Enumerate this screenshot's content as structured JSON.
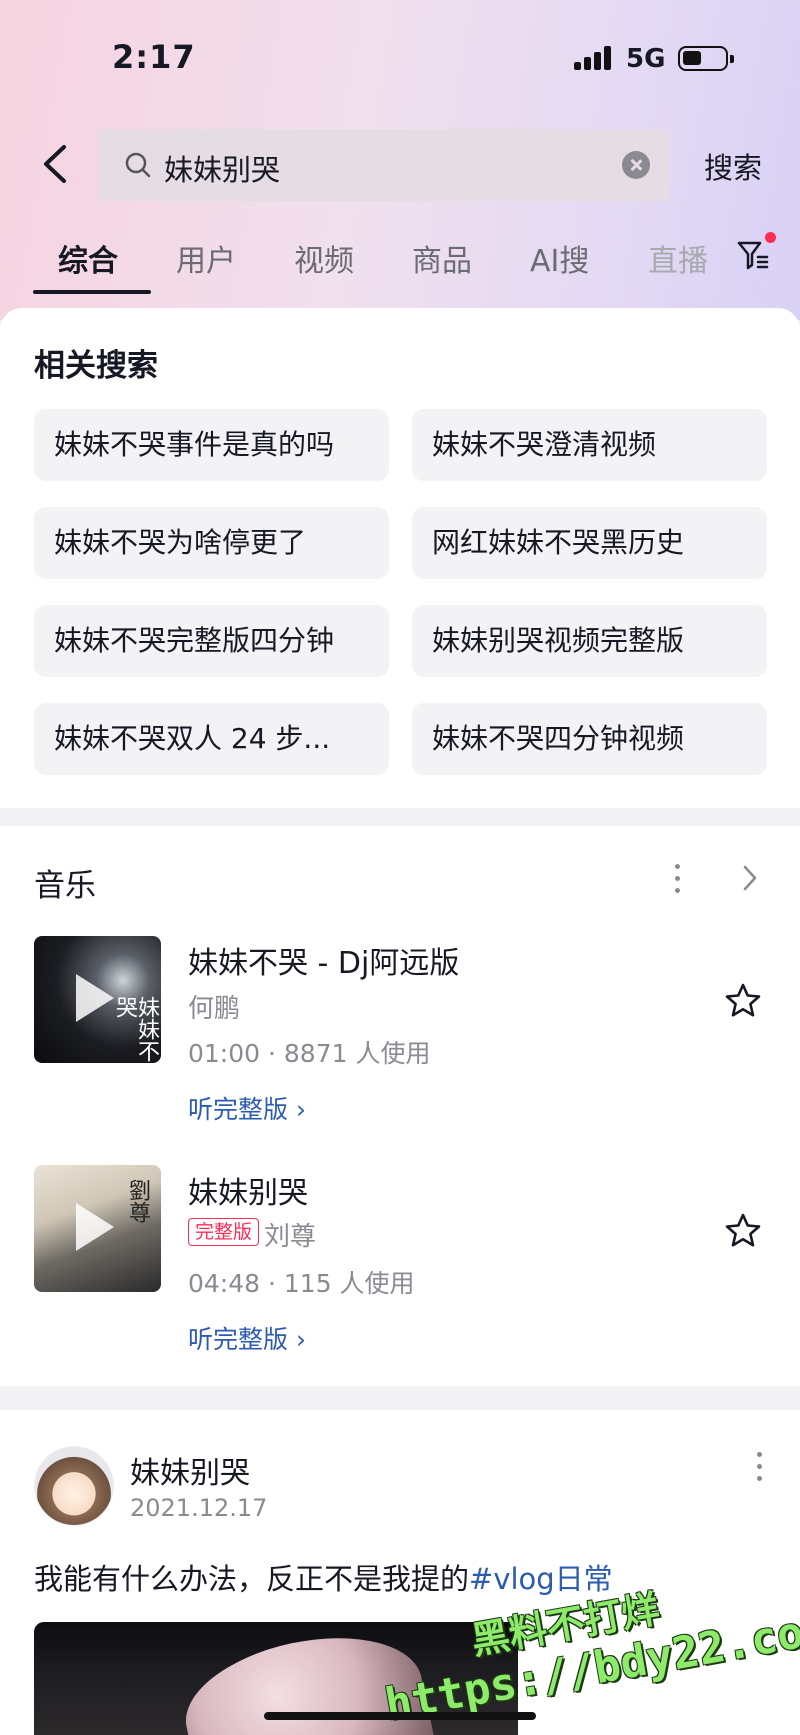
{
  "status_bar": {
    "time": "2:17",
    "network": "5G"
  },
  "search": {
    "query": "妹妹别哭",
    "submit_label": "搜索"
  },
  "tabs": [
    {
      "label": "综合",
      "active": true
    },
    {
      "label": "用户"
    },
    {
      "label": "视频"
    },
    {
      "label": "商品"
    },
    {
      "label": "AI搜"
    },
    {
      "label": "直播"
    }
  ],
  "related": {
    "title": "相关搜索",
    "items": [
      "妹妹不哭事件是真的吗",
      "妹妹不哭澄清视频",
      "妹妹不哭为啥停更了",
      "网红妹妹不哭黑历史",
      "妹妹不哭完整版四分钟",
      "妹妹别哭视频完整版",
      "妹妹不哭双人 24 步...",
      "妹妹不哭四分钟视频"
    ]
  },
  "music": {
    "title": "音乐",
    "songs": [
      {
        "title": "妹妹不哭 - Dj阿远版",
        "artist": "何鹏",
        "meta": "01:00 · 8871 人使用",
        "link": "听完整版 ›",
        "cover_text": "妹妹不哭"
      },
      {
        "title": "妹妹别哭",
        "badge": "完整版",
        "artist": "刘尊",
        "meta": "04:48 · 115 人使用",
        "link": "听完整版 ›",
        "cover_text": "劉尊"
      }
    ]
  },
  "post": {
    "author": "妹妹别哭",
    "date": "2021.12.17",
    "text": "我能有什么办法，反正不是我提的",
    "hashtag": "#vlog日常"
  },
  "watermark": {
    "line1": "黑料不打烊",
    "line2": "https://bdy22.co"
  },
  "colors": {
    "accent_red": "#fe2c55",
    "link_blue": "#2d5bb0",
    "text": "#161823",
    "muted": "#8a8a93"
  }
}
